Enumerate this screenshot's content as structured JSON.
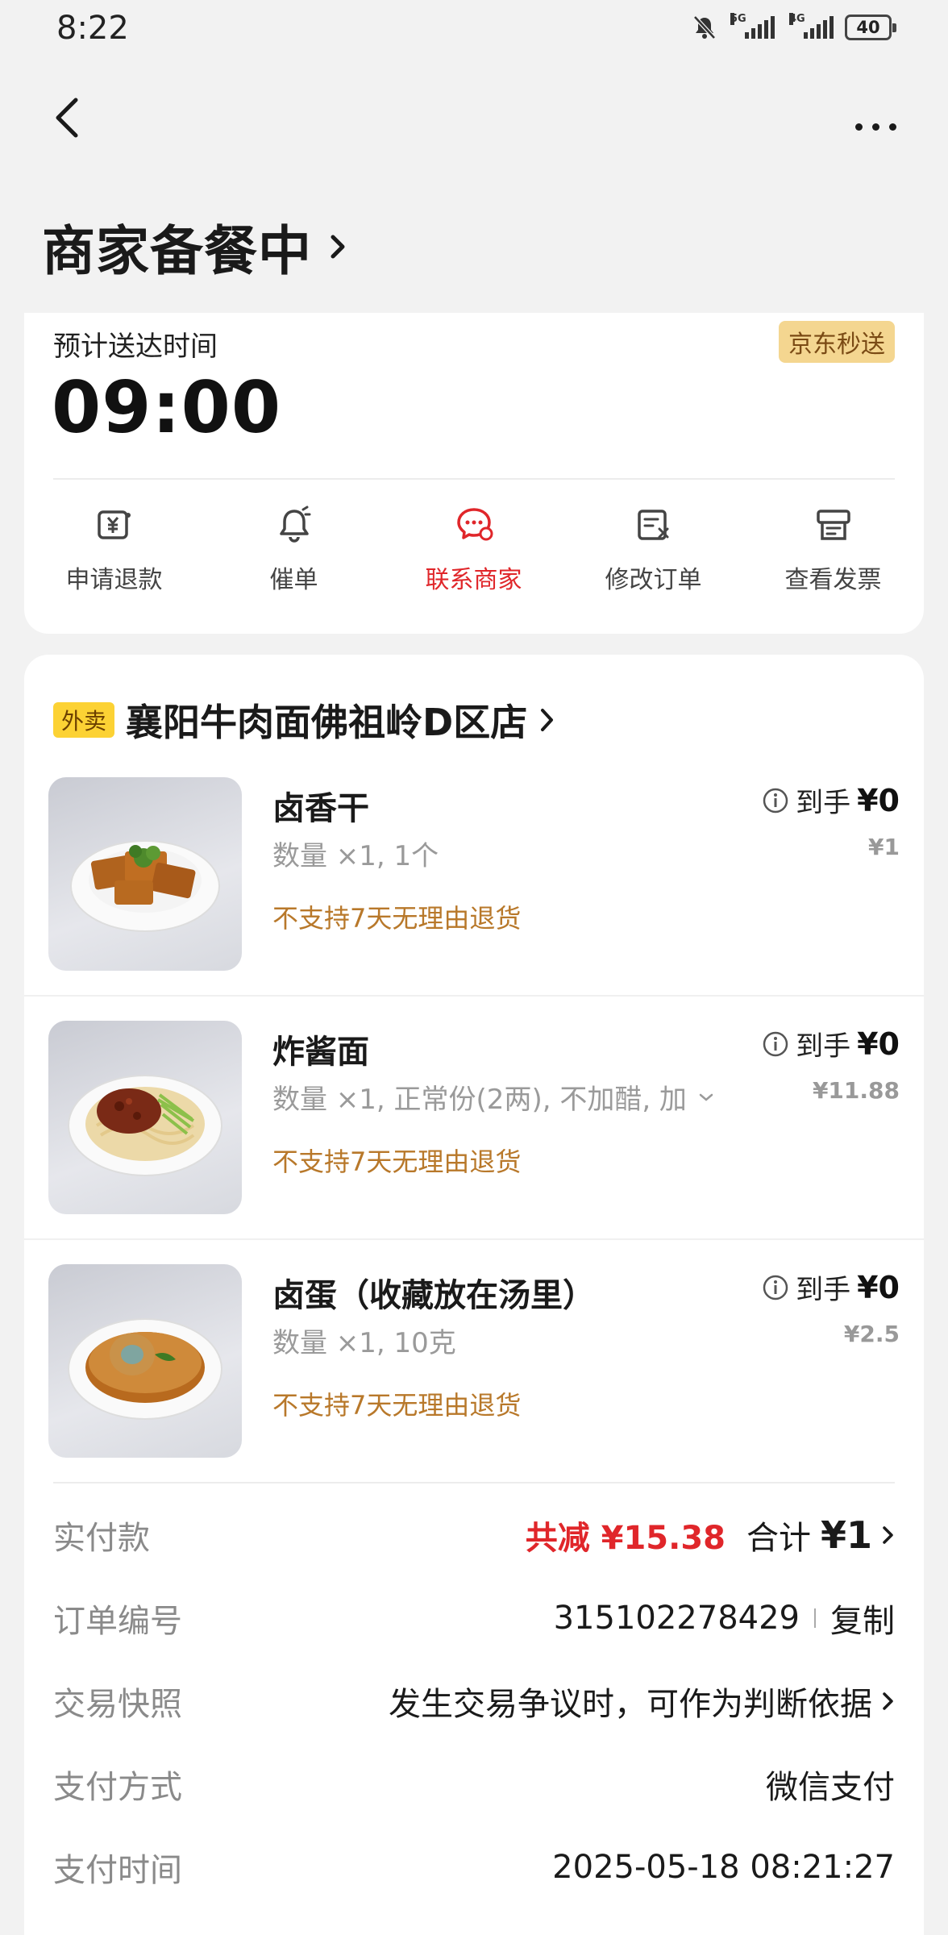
{
  "status_bar": {
    "time": "8:22",
    "battery": "40",
    "sig1_tag": "5G",
    "sig2_tag": "4G"
  },
  "header": {
    "title": "商家备餐中"
  },
  "delivery": {
    "eta_label": "预计送达时间",
    "eta_time": "09:00",
    "badge": "京东秒送",
    "actions": [
      {
        "label": "申请退款",
        "icon": "refund-icon"
      },
      {
        "label": "催单",
        "icon": "bell-icon"
      },
      {
        "label": "联系商家",
        "icon": "chat-icon"
      },
      {
        "label": "修改订单",
        "icon": "edit-order-icon"
      },
      {
        "label": "查看发票",
        "icon": "invoice-icon"
      }
    ]
  },
  "store": {
    "tag": "外卖",
    "name": "襄阳牛肉面佛祖岭D区店"
  },
  "items": [
    {
      "name": "卤香干",
      "qty": "数量 ×1, 1个",
      "price_label": "到手",
      "price": "¥0",
      "orig_price": "¥1",
      "note": "不支持7天无理由退货"
    },
    {
      "name": "炸酱面",
      "qty": "数量 ×1, 正常份(2两), 不加醋, 加",
      "price_label": "到手",
      "price": "¥0",
      "orig_price": "¥11.88",
      "note": "不支持7天无理由退货"
    },
    {
      "name": "卤蛋（收藏放在汤里）",
      "qty": "数量 ×1, 10克",
      "price_label": "到手",
      "price": "¥0",
      "orig_price": "¥2.5",
      "note": "不支持7天无理由退货"
    }
  ],
  "summary": {
    "paid": {
      "label": "实付款",
      "discount": "共减 ¥15.38",
      "total_label": "合计",
      "total": "¥1"
    },
    "order_no": {
      "label": "订单编号",
      "value": "315102278429",
      "copy": "复制"
    },
    "snapshot": {
      "label": "交易快照",
      "value": "发生交易争议时，可作为判断依据"
    },
    "pay_method": {
      "label": "支付方式",
      "value": "微信支付"
    },
    "pay_time": {
      "label": "支付时间",
      "value": "2025-05-18 08:21:27"
    }
  },
  "colors": {
    "accent_red": "#e0262a",
    "note_orange": "#b8782a",
    "badge_gold": "#f4d690",
    "tag_yellow": "#fcd234"
  }
}
